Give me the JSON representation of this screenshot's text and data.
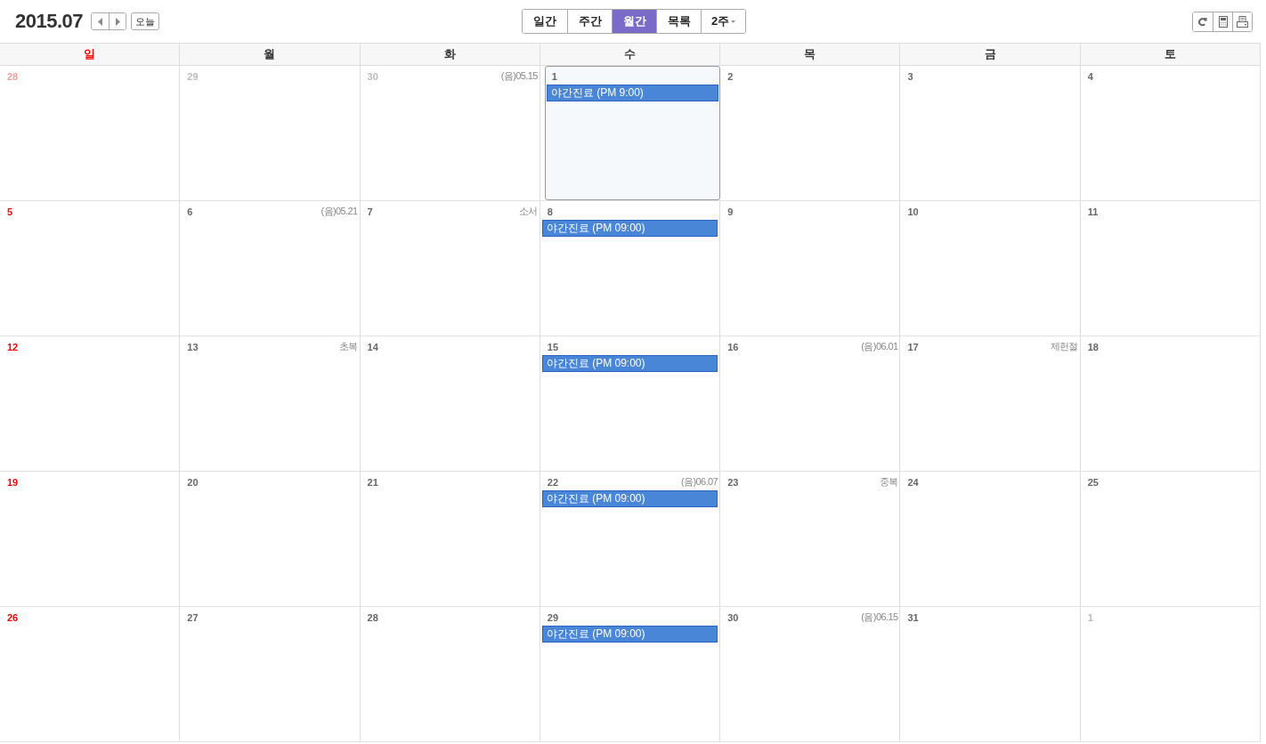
{
  "header": {
    "title": "2015.07",
    "today_button": "오늘"
  },
  "view_tabs": [
    {
      "label": "일간",
      "kind": "view",
      "selected": false
    },
    {
      "label": "주간",
      "kind": "view",
      "selected": false
    },
    {
      "label": "월간",
      "kind": "view",
      "selected": true
    },
    {
      "label": "목록",
      "kind": "view",
      "selected": false
    },
    {
      "label": "2주",
      "kind": "dropdown",
      "selected": false
    }
  ],
  "weekdays": [
    {
      "label": "일",
      "kind": "sunday"
    },
    {
      "label": "월",
      "kind": "weekday"
    },
    {
      "label": "화",
      "kind": "weekday"
    },
    {
      "label": "수",
      "kind": "weekday"
    },
    {
      "label": "목",
      "kind": "weekday"
    },
    {
      "label": "금",
      "kind": "weekday"
    },
    {
      "label": "토",
      "kind": "weekday"
    }
  ],
  "weeks": [
    {
      "days": [
        {
          "date": "28",
          "other_month": true,
          "today": false
        },
        {
          "date": "29",
          "other_month": true,
          "today": false
        },
        {
          "date": "30",
          "other_month": true,
          "today": false,
          "note": "(음)05.15"
        },
        {
          "date": "1",
          "other_month": false,
          "today": true,
          "events": [
            "야간진료 (PM 9:00)"
          ]
        },
        {
          "date": "2",
          "other_month": false,
          "today": false
        },
        {
          "date": "3",
          "other_month": false,
          "today": false
        },
        {
          "date": "4",
          "other_month": false,
          "today": false
        }
      ]
    },
    {
      "days": [
        {
          "date": "5",
          "other_month": false,
          "today": false
        },
        {
          "date": "6",
          "other_month": false,
          "today": false,
          "note": "(음)05.21"
        },
        {
          "date": "7",
          "other_month": false,
          "today": false,
          "note": "소서"
        },
        {
          "date": "8",
          "other_month": false,
          "today": false,
          "events": [
            "야간진료 (PM 09:00)"
          ]
        },
        {
          "date": "9",
          "other_month": false,
          "today": false
        },
        {
          "date": "10",
          "other_month": false,
          "today": false
        },
        {
          "date": "11",
          "other_month": false,
          "today": false
        }
      ]
    },
    {
      "days": [
        {
          "date": "12",
          "other_month": false,
          "today": false
        },
        {
          "date": "13",
          "other_month": false,
          "today": false,
          "note": "초복"
        },
        {
          "date": "14",
          "other_month": false,
          "today": false
        },
        {
          "date": "15",
          "other_month": false,
          "today": false,
          "events": [
            "야간진료 (PM 09:00)"
          ]
        },
        {
          "date": "16",
          "other_month": false,
          "today": false,
          "note": "(음)06.01"
        },
        {
          "date": "17",
          "other_month": false,
          "today": false,
          "note": "제헌절"
        },
        {
          "date": "18",
          "other_month": false,
          "today": false
        }
      ]
    },
    {
      "days": [
        {
          "date": "19",
          "other_month": false,
          "today": false
        },
        {
          "date": "20",
          "other_month": false,
          "today": false
        },
        {
          "date": "21",
          "other_month": false,
          "today": false
        },
        {
          "date": "22",
          "other_month": false,
          "today": false,
          "note": "(음)06.07",
          "events": [
            "야간진료 (PM 09:00)"
          ]
        },
        {
          "date": "23",
          "other_month": false,
          "today": false,
          "note": "중복"
        },
        {
          "date": "24",
          "other_month": false,
          "today": false
        },
        {
          "date": "25",
          "other_month": false,
          "today": false
        }
      ]
    },
    {
      "days": [
        {
          "date": "26",
          "other_month": false,
          "today": false
        },
        {
          "date": "27",
          "other_month": false,
          "today": false
        },
        {
          "date": "28",
          "other_month": false,
          "today": false
        },
        {
          "date": "29",
          "other_month": false,
          "today": false,
          "events": [
            "야간진료 (PM 09:00)"
          ]
        },
        {
          "date": "30",
          "other_month": false,
          "today": false,
          "note": "(음)06.15"
        },
        {
          "date": "31",
          "other_month": false,
          "today": false
        },
        {
          "date": "1",
          "other_month": true,
          "today": false
        }
      ]
    }
  ]
}
